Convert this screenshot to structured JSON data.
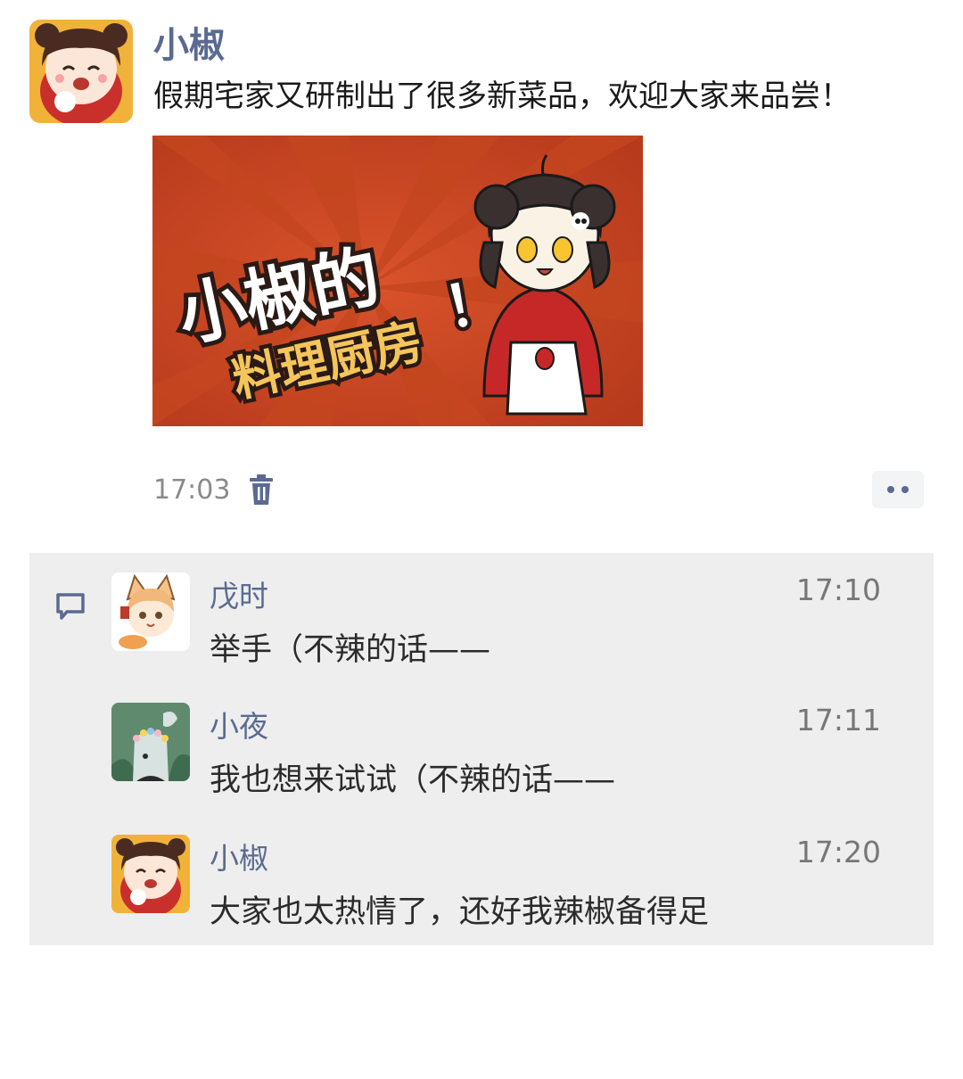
{
  "post": {
    "author": "小椒",
    "text": "假期宅家又研制出了很多新菜品，欢迎大家来品尝！",
    "image": {
      "title_line1": "小椒的",
      "title_line2": "料理厨房",
      "exclaim": "！"
    },
    "time": "17:03"
  },
  "icons": {
    "delete": "trash-icon",
    "more": "more-dots-icon",
    "comment": "comment-bubble-icon"
  },
  "colors": {
    "name_accent": "#5b6a92",
    "comments_bg": "#eeeeee",
    "banner_red": "#c8421f"
  },
  "comments": [
    {
      "name": "戊时",
      "time": "17:10",
      "text": "举手（不辣的话——"
    },
    {
      "name": "小夜",
      "time": "17:11",
      "text": "我也想来试试（不辣的话——"
    },
    {
      "name": "小椒",
      "time": "17:20",
      "text": "大家也太热情了，还好我辣椒备得足"
    }
  ]
}
